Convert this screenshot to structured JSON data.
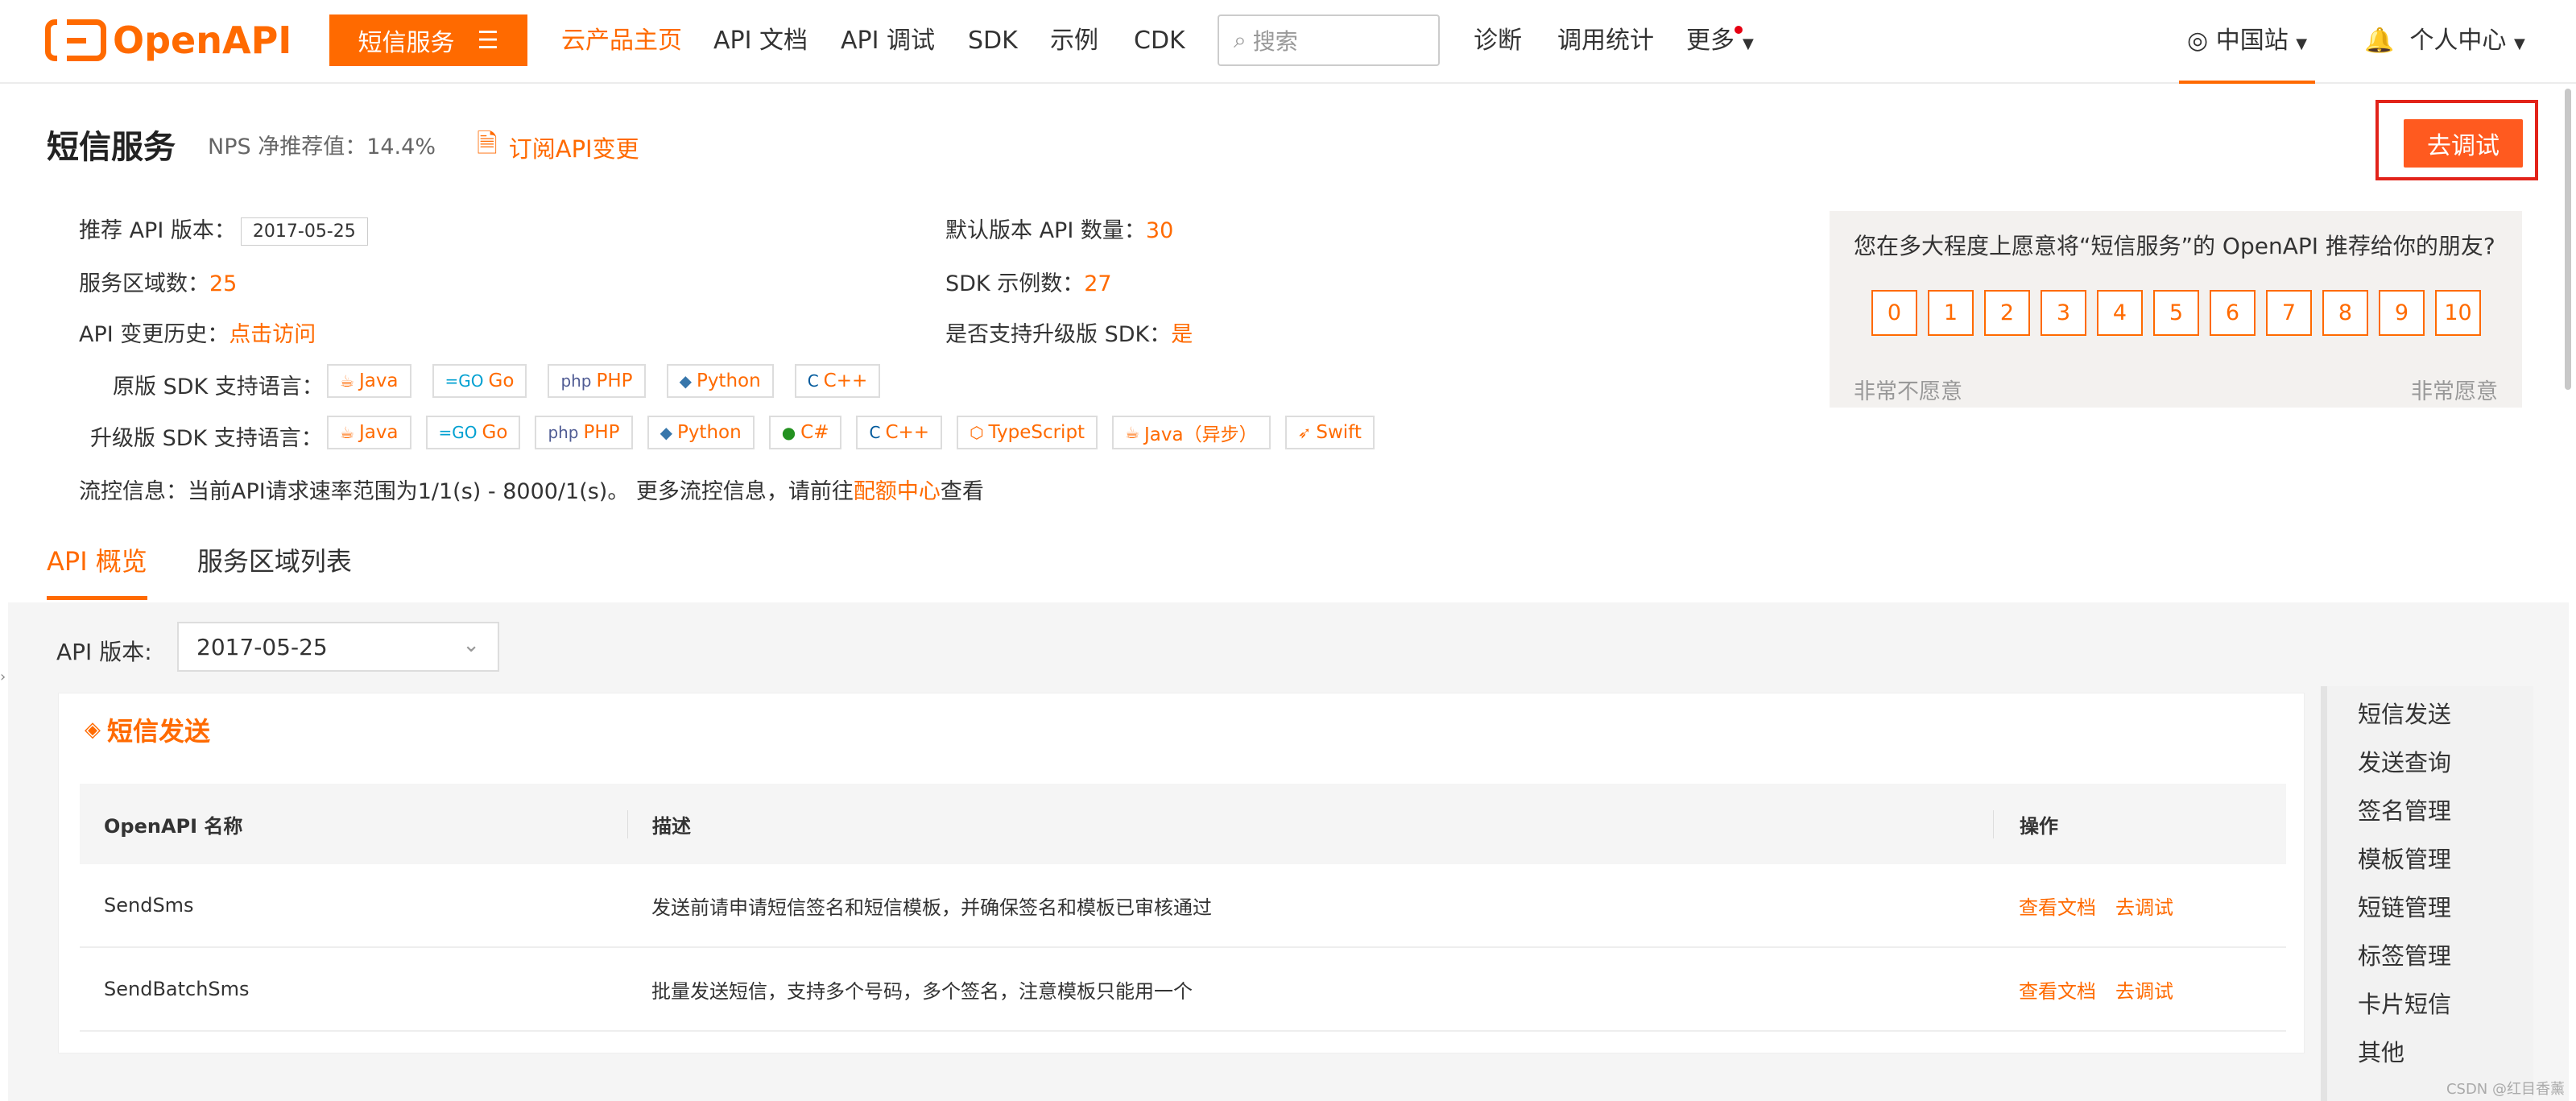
{
  "nav": {
    "logo": "OpenAPI",
    "service_button": "短信服务",
    "items": [
      "云产品主页",
      "API 文档",
      "API 调试",
      "SDK",
      "示例",
      "CDK"
    ],
    "search_placeholder": "搜索",
    "right_items": [
      "诊断",
      "调用统计",
      "更多"
    ],
    "region": "中国站",
    "user": "个人中心"
  },
  "header": {
    "title": "短信服务",
    "nps": "NPS 净推荐值：14.4%",
    "subscribe": "订阅API变更",
    "debug_button": "去调试"
  },
  "info": {
    "api_version_label": "推荐 API 版本：",
    "api_version": "2017-05-25",
    "regions_label": "服务区域数：",
    "regions": "25",
    "history_label": "API 变更历史：",
    "history_link": "点击访问",
    "default_api_label": "默认版本 API 数量：",
    "default_api": "30",
    "sdk_examples_label": "SDK 示例数：",
    "sdk_examples": "27",
    "upgrade_label": "是否支持升级版 SDK：",
    "upgrade": "是",
    "orig_sdk_label": "原版 SDK 支持语言：",
    "orig_sdk": [
      "Java",
      "Go",
      "PHP",
      "Python",
      "C++"
    ],
    "upg_sdk_label": "升级版 SDK 支持语言：",
    "upg_sdk": [
      "Java",
      "Go",
      "PHP",
      "Python",
      "C#",
      "C++",
      "TypeScript",
      "Java（异步）",
      "Swift"
    ],
    "flow_prefix": "流控信息：当前API请求速率范围为1/1(s) - 8000/1(s)。 更多流控信息，请前往",
    "flow_link": "配额中心",
    "flow_suffix": "查看"
  },
  "survey": {
    "question": "您在多大程度上愿意将“短信服务”的 OpenAPI 推荐给你的朋友?",
    "scores": [
      "0",
      "1",
      "2",
      "3",
      "4",
      "5",
      "6",
      "7",
      "8",
      "9",
      "10"
    ],
    "low": "非常不愿意",
    "high": "非常愿意"
  },
  "tabs": [
    "API 概览",
    "服务区域列表"
  ],
  "api_version_select": {
    "label": "API 版本:",
    "value": "2017-05-25"
  },
  "card": {
    "title": "短信发送",
    "columns": [
      "OpenAPI 名称",
      "描述",
      "操作"
    ],
    "rows": [
      {
        "name": "SendSms",
        "desc": "发送前请申请短信签名和短信模板，并确保签名和模板已审核通过",
        "a1": "查看文档",
        "a2": "去调试"
      },
      {
        "name": "SendBatchSms",
        "desc": "批量发送短信，支持多个号码，多个签名，注意模板只能用一个",
        "a1": "查看文档",
        "a2": "去调试"
      }
    ]
  },
  "side_nav": [
    "短信发送",
    "发送查询",
    "签名管理",
    "模板管理",
    "短链管理",
    "标签管理",
    "卡片短信",
    "其他"
  ],
  "watermark": "CSDN @红目香薰",
  "colors": {
    "accent": "#ff6a00",
    "highlight_frame": "#e2231a"
  }
}
